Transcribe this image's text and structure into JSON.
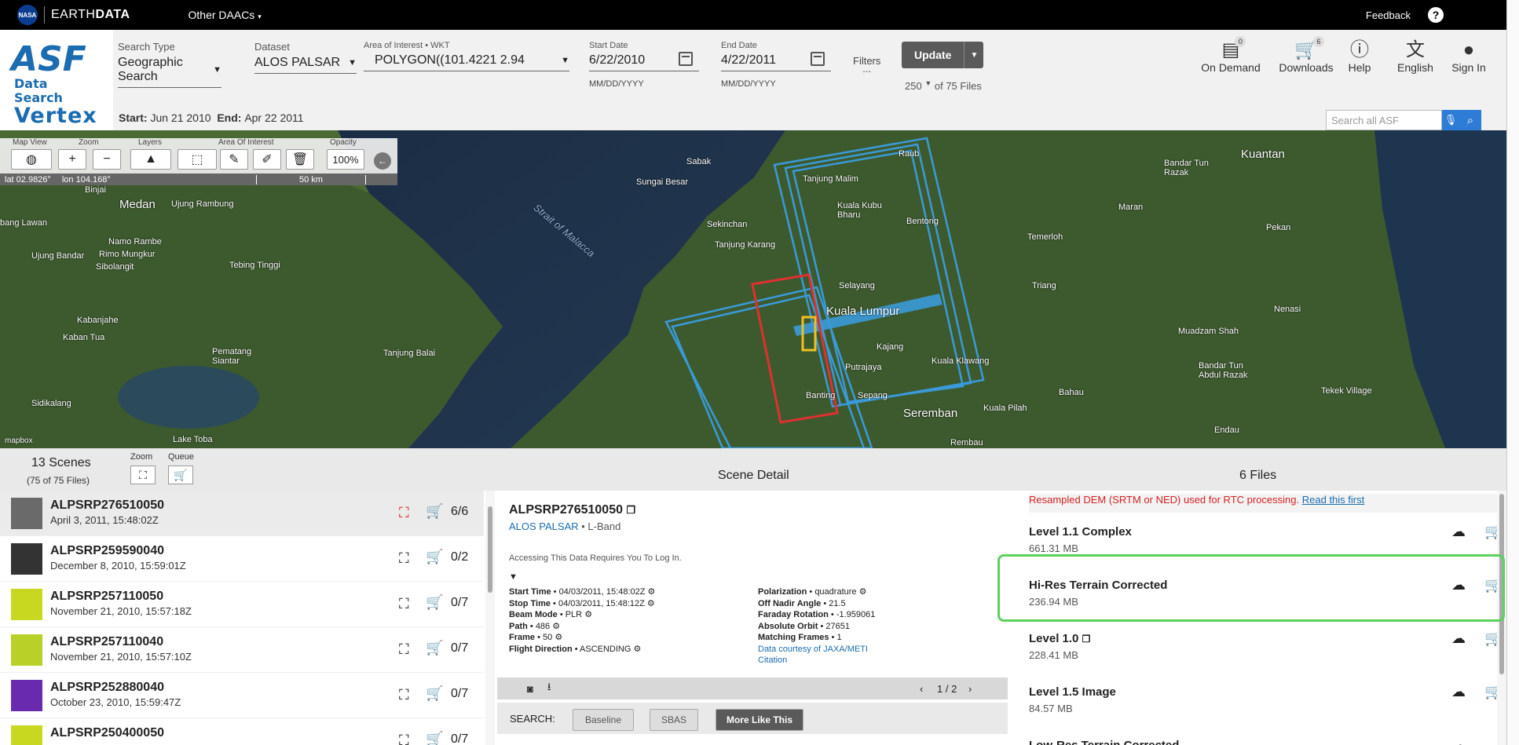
{
  "topbar": {
    "nasa": "NASA",
    "earthdata_light": "EARTH",
    "earthdata_bold": "DATA",
    "other_daacs": "Other DAACs",
    "feedback": "Feedback"
  },
  "logo": {
    "asf": "ASF",
    "data_search": "Data Search",
    "vertex": "Vertex"
  },
  "search": {
    "search_type_label": "Search Type",
    "search_type": "Geographic Search",
    "dataset_label": "Dataset",
    "dataset": "ALOS PALSAR",
    "aoi_label": "Area of Interest • WKT",
    "aoi": "POLYGON((101.4221 2.94",
    "start_label": "Start Date",
    "start": "6/22/2010",
    "start_fmt": "MM/DD/YYYY",
    "end_label": "End Date",
    "end": "4/22/2011",
    "end_fmt": "MM/DD/YYYY",
    "filters": "Filters",
    "filters_dots": "...",
    "update": "Update",
    "max_results": "250",
    "of_files": "of 75 Files",
    "date_start_label": "Start:",
    "date_start": "Jun 21 2010",
    "date_end_label": "End:",
    "date_end": "Apr 22 2011",
    "search_asf_placeholder": "Search all ASF"
  },
  "header_buttons": [
    {
      "label": "On Demand",
      "badge": "0"
    },
    {
      "label": "Downloads",
      "badge": "6"
    },
    {
      "label": "Help"
    },
    {
      "label": "English"
    },
    {
      "label": "Sign In"
    }
  ],
  "map_tools": {
    "map_view": "Map View",
    "zoom": "Zoom",
    "layers": "Layers",
    "aoi": "Area Of Interest",
    "opacity": "Opacity",
    "opacity_val": "100%",
    "lat": "lat 02.9826°",
    "lon": "lon 104.168°",
    "scale": "50 km",
    "attribution": "mapbox"
  },
  "map_labels": [
    "Medan",
    "Ujung Rambung",
    "Binjai",
    "bang Lawan",
    "Namo Rambe",
    "Rimo Mungkur",
    "Sibolangit",
    "Ujung Bandar",
    "Tebing Tinggi",
    "Kabanjahe",
    "Kaban Tua",
    "Pematang Siantar",
    "Tanjung Balai",
    "Sidikalang",
    "Lake Toba",
    "Strait of Malacca",
    "Sabak",
    "Sungai Besar",
    "Tanjung Malim",
    "Kuala Kubu Bharu",
    "Sekinchan",
    "Tanjung Karang",
    "Bentong",
    "Selayang",
    "Kuala Lumpur",
    "Kajang",
    "Putrajaya",
    "Kuala Klawang",
    "Banting",
    "Sepang",
    "Seremban",
    "Kuala Pilah",
    "Raub",
    "Kuantan",
    "Bandar Tun Razak",
    "Maran",
    "Pekan",
    "Temerloh",
    "Triang",
    "Nenasi",
    "Muadzam Shah",
    "Bandar Tun Abdul Razak",
    "Bahau",
    "Tekek Village",
    "Endau",
    "Rembau"
  ],
  "scenes_panel": {
    "title": "13 Scenes",
    "subtitle": "(75 of 75 Files)",
    "zoom": "Zoom",
    "queue": "Queue"
  },
  "scenes": [
    {
      "name": "ALPSRP276510050",
      "date": "April 3, 2011, 15:48:02Z",
      "count": "6/6"
    },
    {
      "name": "ALPSRP259590040",
      "date": "December 8, 2010, 15:59:01Z",
      "count": "0/2"
    },
    {
      "name": "ALPSRP257110050",
      "date": "November 21, 2010, 15:57:18Z",
      "count": "0/7"
    },
    {
      "name": "ALPSRP257110040",
      "date": "November 21, 2010, 15:57:10Z",
      "count": "0/7"
    },
    {
      "name": "ALPSRP252880040",
      "date": "October 23, 2010, 15:59:47Z",
      "count": "0/7"
    },
    {
      "name": "ALPSRP250400050",
      "date": "",
      "count": "0/7"
    }
  ],
  "detail": {
    "title": "Scene Detail",
    "name": "ALPSRP276510050",
    "dataset": "ALOS PALSAR",
    "band": "• L-Band",
    "note": "Accessing This Data Requires You To Log In.",
    "left_props": [
      {
        "k": "Start Time",
        "v": "• 04/03/2011, 15:48:02Z"
      },
      {
        "k": "Stop Time",
        "v": "• 04/03/2011, 15:48:12Z"
      },
      {
        "k": "Beam Mode",
        "v": "• PLR"
      },
      {
        "k": "Path",
        "v": "• 486"
      },
      {
        "k": "Frame",
        "v": "• 50"
      },
      {
        "k": "Flight Direction",
        "v": "• ASCENDING"
      }
    ],
    "right_props": [
      {
        "k": "Polarization",
        "v": "• quadrature"
      },
      {
        "k": "Off Nadir Angle",
        "v": "• 21.5"
      },
      {
        "k": "Faraday Rotation",
        "v": "• -1.959061"
      },
      {
        "k": "Absolute Orbit",
        "v": "• 27651"
      },
      {
        "k": "Matching Frames",
        "v": "• 1"
      }
    ],
    "courtesy": "Data courtesy of JAXA/METI",
    "citation": "Citation",
    "pager": "1 / 2",
    "search_label": "SEARCH:",
    "baseline": "Baseline",
    "sbas": "SBAS",
    "more_like": "More Like This"
  },
  "files_panel": {
    "title": "6 Files",
    "warning": "Resampled DEM (SRTM or NED) used for RTC processing.",
    "read_first": "Read this first",
    "files": [
      {
        "name": "Level 1.1 Complex",
        "size": "661.31 MB"
      },
      {
        "name": "Hi-Res Terrain Corrected",
        "size": "236.94 MB"
      },
      {
        "name": "Level 1.0",
        "size": "228.41 MB"
      },
      {
        "name": "Level 1.5 Image",
        "size": "84.57 MB"
      },
      {
        "name": "Low-Res Terrain Corrected",
        "size": ""
      }
    ]
  },
  "colors": {
    "accent": "#1b6cb0",
    "highlight": "#5ed15e",
    "warning": "#d62020",
    "selected_footprint": "#e03030",
    "aoi": "#f0c020",
    "footprint": "#3a9ad9"
  }
}
